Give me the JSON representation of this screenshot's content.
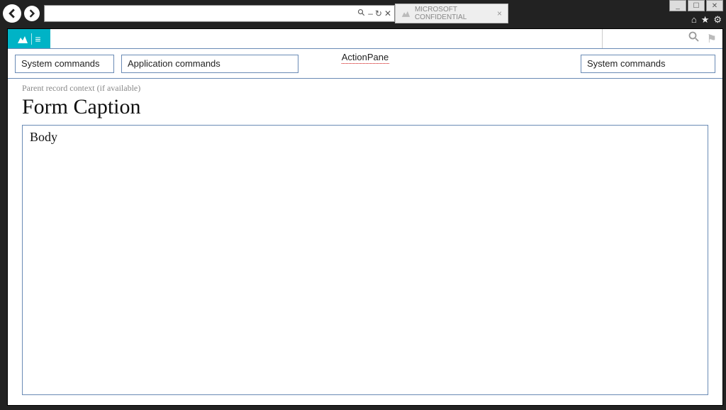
{
  "browser": {
    "tab_title": "MICROSOFT CONFIDENTIAL",
    "address_search_hint": "Search",
    "refresh_glyph": "↻",
    "stop_glyph": "✕",
    "search_sep": "–"
  },
  "window_controls": {
    "min": "_",
    "max": "☐",
    "close": "✕"
  },
  "browser_icons": {
    "home": "⌂",
    "fav": "★",
    "settings": "⚙"
  },
  "app": {
    "search_placeholder": "",
    "flag_glyph": "⚑"
  },
  "action_pane": {
    "label": "ActionPane",
    "system_commands_left": "System commands",
    "application_commands": "Application commands",
    "system_commands_right": "System commands"
  },
  "form": {
    "parent_context": "Parent record context (if available)",
    "caption": "Form Caption",
    "body_label": "Body"
  }
}
